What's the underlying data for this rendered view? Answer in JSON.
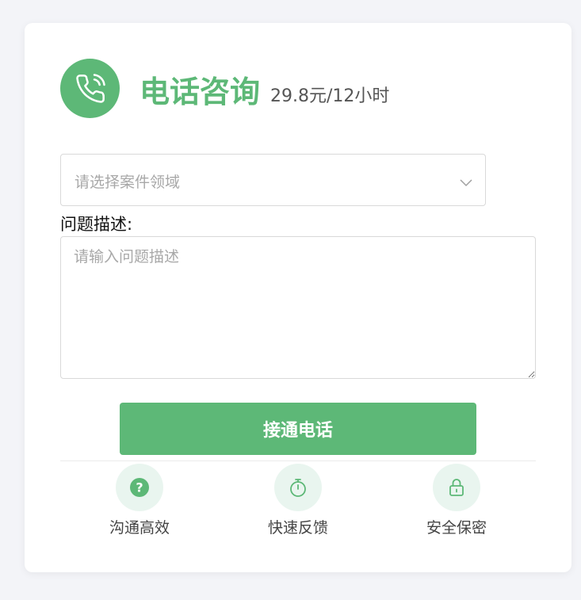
{
  "header": {
    "icon": "phone-icon",
    "title": "电话咨询",
    "price": "29.8元/12小时"
  },
  "form": {
    "select_placeholder": "请选择案件领域",
    "select_icon": "chevron-down-icon",
    "description_label": "问题描述:",
    "description_placeholder": "请输入问题描述",
    "submit_label": "接通电话"
  },
  "features": [
    {
      "label": "沟通高效",
      "icon": "question-icon"
    },
    {
      "label": "快速反馈",
      "icon": "stopwatch-icon"
    },
    {
      "label": "安全保密",
      "icon": "lock-icon"
    }
  ],
  "colors": {
    "accent": "#5db877",
    "icon_bg": "#e9f5ef",
    "page_bg": "#f3f4f8"
  }
}
